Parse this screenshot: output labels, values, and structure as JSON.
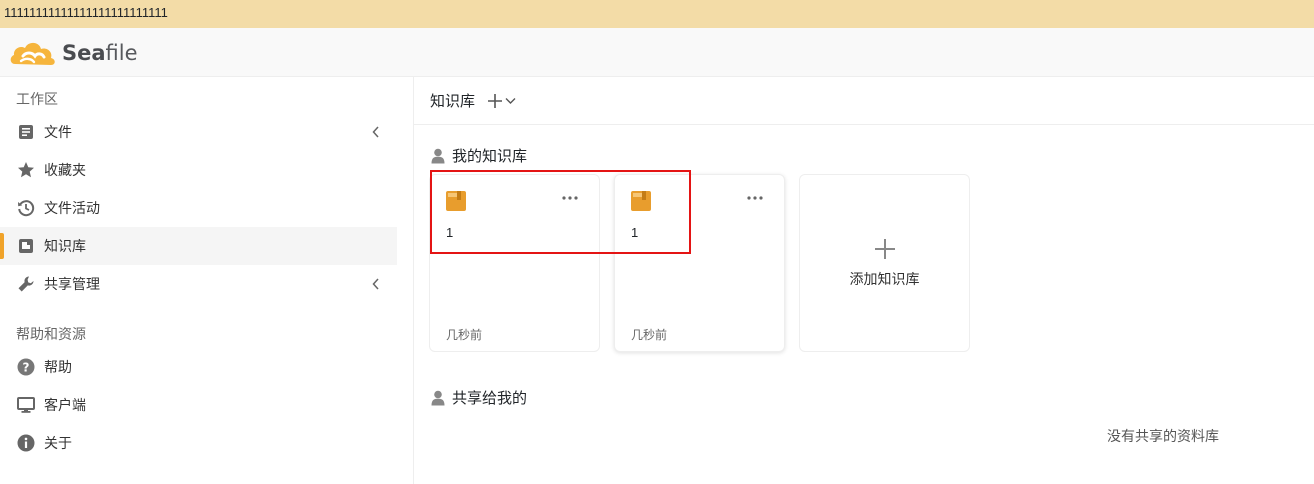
{
  "banner": {
    "text": "11111111111111111111111111"
  },
  "app": {
    "logo_text_bold": "Sea",
    "logo_text_rest": "file"
  },
  "sidebar": {
    "workspace_heading": "工作区",
    "help_heading": "帮助和资源",
    "items": [
      {
        "label": "文件",
        "icon": "file-icon",
        "has_chevron": true
      },
      {
        "label": "收藏夹",
        "icon": "star-icon"
      },
      {
        "label": "文件活动",
        "icon": "history-icon"
      },
      {
        "label": "知识库",
        "icon": "wiki-icon",
        "active": true
      },
      {
        "label": "共享管理",
        "icon": "wrench-icon",
        "has_chevron": true
      }
    ],
    "help_items": [
      {
        "label": "帮助",
        "icon": "question-icon"
      },
      {
        "label": "客户端",
        "icon": "monitor-icon"
      },
      {
        "label": "关于",
        "icon": "info-icon"
      }
    ]
  },
  "main": {
    "title": "知识库",
    "my_section_title": "我的知识库",
    "wikis": [
      {
        "name": "1",
        "time": "几秒前"
      },
      {
        "name": "1",
        "time": "几秒前"
      }
    ],
    "add_card_label": "添加知识库",
    "shared_section_title": "共享给我的",
    "shared_empty": "没有共享的资料库"
  },
  "colors": {
    "accent": "#f0a32a",
    "book": "#e89d2d",
    "highlight": "#e41414",
    "banner": "#f3dca7"
  }
}
